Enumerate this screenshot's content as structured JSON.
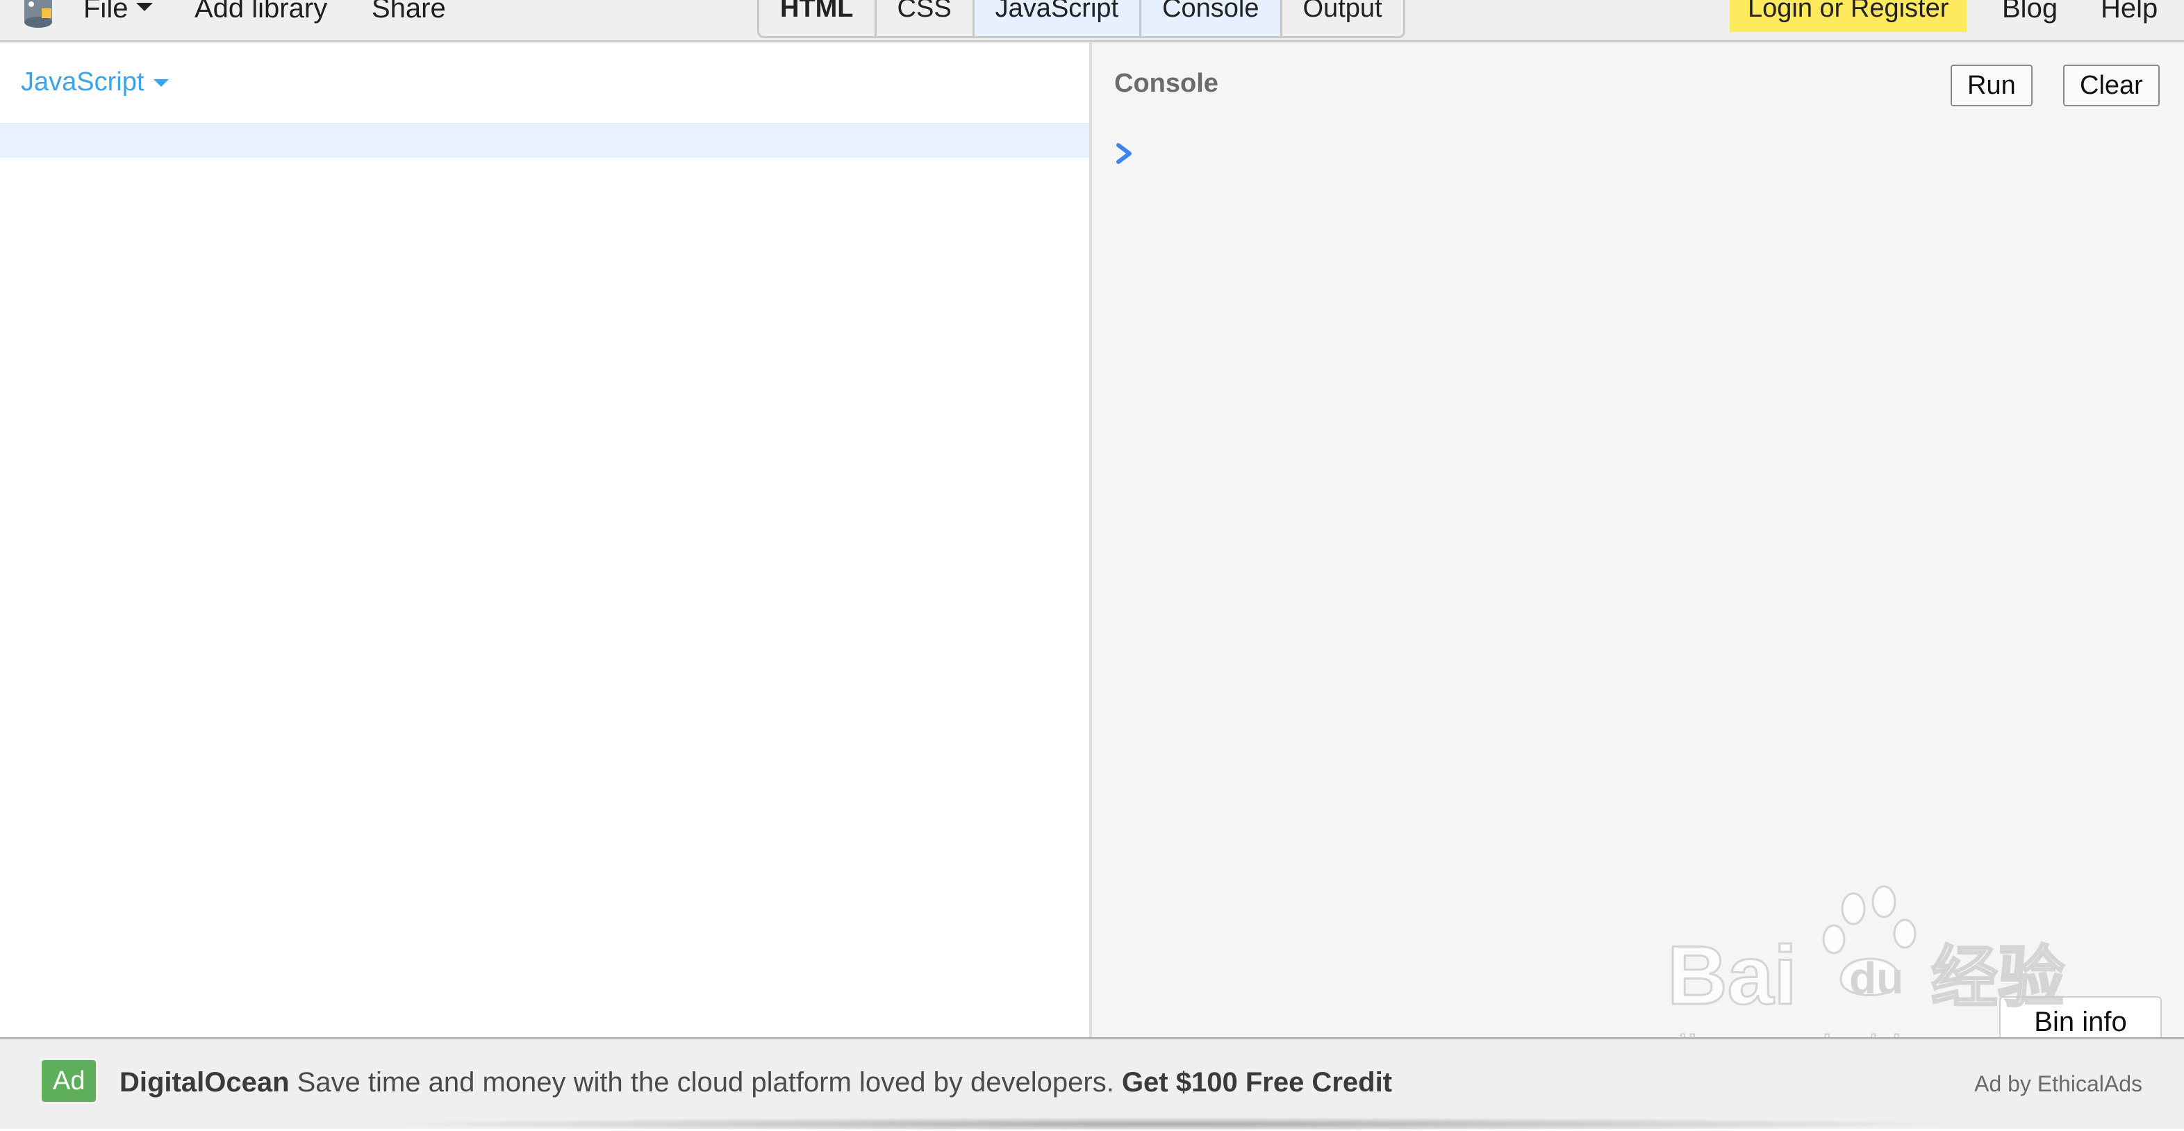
{
  "topbar": {
    "logo_icon": "jsbin-logo-icon",
    "file_label": "File",
    "add_library_label": "Add library",
    "share_label": "Share",
    "panel_tabs": [
      {
        "label": "HTML",
        "active": false
      },
      {
        "label": "CSS",
        "active": false
      },
      {
        "label": "JavaScript",
        "active": true
      },
      {
        "label": "Console",
        "active": true
      },
      {
        "label": "Output",
        "active": false
      }
    ],
    "login_label": "Login or Register",
    "blog_label": "Blog",
    "help_label": "Help",
    "login_color": "#ffe95c"
  },
  "editor": {
    "language_label": "JavaScript",
    "language_color": "#3ea3e8",
    "active_line_color": "#e8f2fe"
  },
  "console": {
    "title": "Console",
    "run_label": "Run",
    "clear_label": "Clear",
    "prompt_icon": "chevron-right-icon",
    "prompt_color": "#3b82f6",
    "bin_info_label": "Bin info"
  },
  "ad": {
    "badge": "Ad",
    "brand": "DigitalOcean",
    "text": " Save time and money with the cloud platform loved by developers. ",
    "cta": "Get $100 Free Credit",
    "by": "Ad by EthicalAds",
    "badge_color": "#5fae5b"
  },
  "watermark": {
    "logo_text": "Bai",
    "logo_suffix": "du",
    "chinese": "经验",
    "url": "jingyan.baidu.com"
  }
}
